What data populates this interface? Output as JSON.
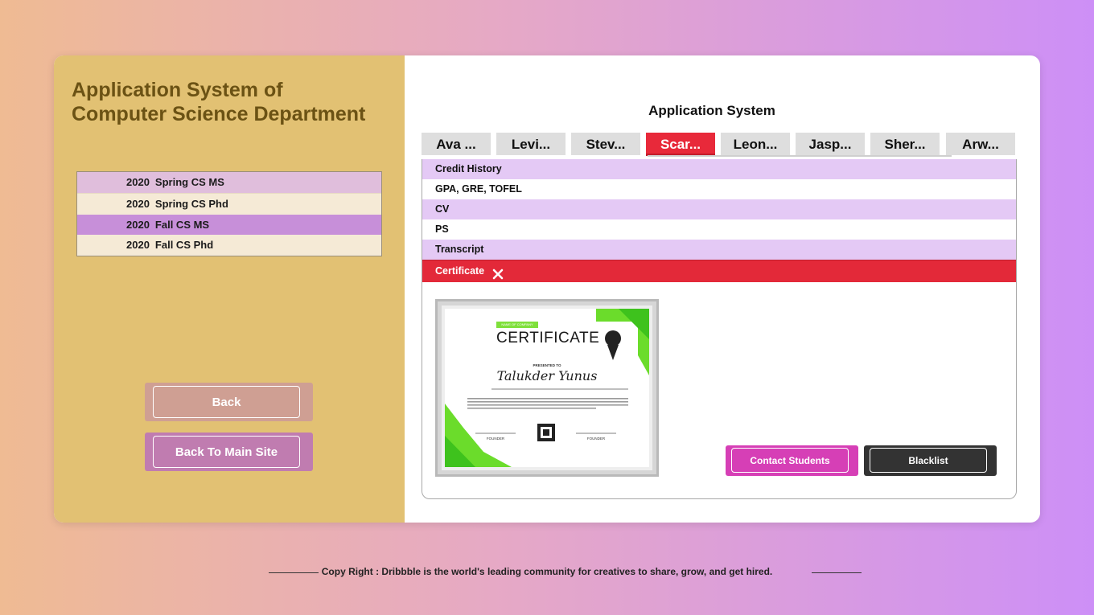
{
  "left_panel": {
    "title_line1": "Application System of",
    "title_line2": "Computer Science Department",
    "programs": [
      {
        "year": "2020",
        "label": "Spring CS MS"
      },
      {
        "year": "2020",
        "label": "Spring CS Phd"
      },
      {
        "year": "2020",
        "label": "Fall CS MS"
      },
      {
        "year": "2020",
        "label": "Fall CS Phd"
      }
    ],
    "selected_program_index": 2,
    "back_label": "Back",
    "main_site_label": "Back To Main Site"
  },
  "main": {
    "title": "Application System",
    "tabs": [
      "Ava ...",
      "Levi...",
      "Stev...",
      "Scar...",
      "Leon...",
      "Jasp...",
      "Sher...",
      "Arw..."
    ],
    "active_tab_index": 3,
    "documents": [
      "Credit History",
      "GPA, GRE, TOFEL",
      "CV",
      "PS",
      "Transcript",
      "Certificate"
    ],
    "selected_document_index": 5,
    "certificate": {
      "company": "NAME OF COMPANY",
      "heading": "CERTIFICATE",
      "presented_to": "PRESENTED TO",
      "recipient": "Talukder Yunus",
      "founder_left": "FOUNDER",
      "founder_right": "FOUNDER"
    },
    "contact_label": "Contact Students",
    "blacklist_label": "Blacklist"
  },
  "footer": {
    "text": "Copy Right : Dribbble is the world's leading community for creatives to share, grow, and get hired."
  },
  "colors": {
    "left_panel_bg": "#e2c173",
    "accent_red": "#e8293a",
    "contact_pink": "#d63fb6",
    "blacklist_dark": "#333333",
    "row_lavender": "#e4c9f5"
  }
}
